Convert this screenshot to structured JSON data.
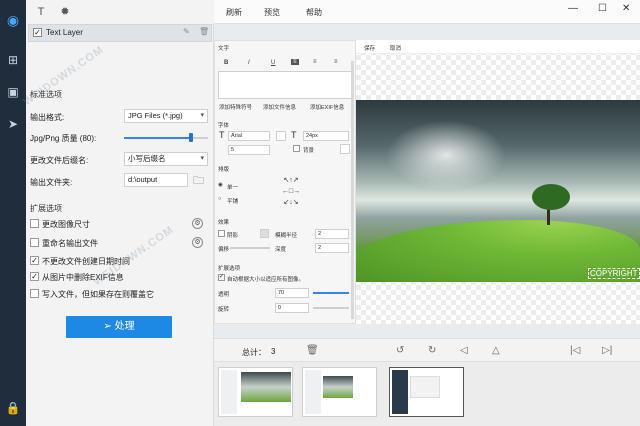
{
  "top_menu": {
    "refresh": "刷新",
    "preview": "预览",
    "help": "帮助"
  },
  "layer": {
    "name": "Text Layer",
    "checked": true
  },
  "standard": {
    "title": "标准选项",
    "output_format_label": "输出格式:",
    "output_format_value": "JPG Files (*.jpg)",
    "quality_label": "Jpg/Png 质量 (80):",
    "quality_value": 80,
    "rename_label": "更改文件后缀名:",
    "rename_value": "小写后缀名",
    "output_folder_label": "输出文件夹:",
    "output_folder_value": "d:\\output"
  },
  "extended": {
    "title": "扩展选项",
    "options": [
      {
        "label": "更改图像尺寸",
        "checked": false
      },
      {
        "label": "重命名输出文件",
        "checked": false
      },
      {
        "label": "不更改文件创建日期时间",
        "checked": true
      },
      {
        "label": "从图片中删除EXIF信息",
        "checked": true
      },
      {
        "label": "写入文件，但如果存在则覆盖它",
        "checked": false
      }
    ]
  },
  "process_button": "处理",
  "settings": {
    "text_section": "文字",
    "format_buttons": [
      "B",
      "I",
      "U"
    ],
    "dropdowns": [
      "添加特殊符号",
      "添加文件信息",
      "添加EXIF信息"
    ],
    "font_section": "字体",
    "font_name": "Arial",
    "font_size": "24px",
    "border_width": "5",
    "bg_label": "背景",
    "align_section": "排版",
    "align_single": "单一",
    "align_tile": "平铺",
    "effect_section": "效果",
    "shadow_label": "阴影",
    "shadow_blur_label": "模糊半径",
    "shadow_blur_value": "2",
    "offset_label": "偏移",
    "depth_label": "深度",
    "depth_value": "2",
    "ext_section": "扩展选项",
    "auto_scale_label": "自动根据大小以适应所有图像。",
    "opacity_label": "透明",
    "opacity_value": "70",
    "rotate_label": "旋转",
    "rotate_value": "0"
  },
  "preview": {
    "tab1": "保存",
    "tab2": "取消",
    "copyright": "COPYRIGHT"
  },
  "bottom": {
    "total_label": "总计：",
    "total_value": "3"
  },
  "watermark": "WEIDOWN.COM"
}
